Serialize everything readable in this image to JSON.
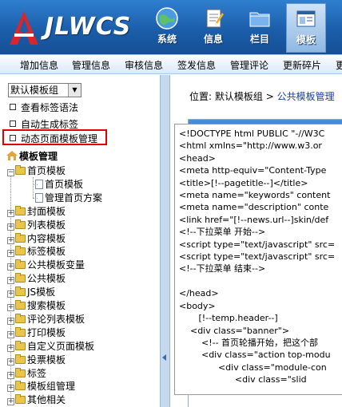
{
  "header": {
    "logo_text": "JLWCS",
    "nav": [
      {
        "label": "系统",
        "icon": "globe-icon"
      },
      {
        "label": "信息",
        "icon": "document-icon"
      },
      {
        "label": "栏目",
        "icon": "folder-icon"
      },
      {
        "label": "模板",
        "icon": "template-icon",
        "active": true
      }
    ],
    "colors": {
      "header_bg": "#1b5eaa",
      "active_tab": "#a9cbee"
    }
  },
  "menubar": {
    "items": [
      "增加信息",
      "管理信息",
      "审核信息",
      "签发信息",
      "管理评论",
      "更新碎片",
      "更新"
    ]
  },
  "sidebar": {
    "group_select": {
      "value": "默认模板组"
    },
    "links": [
      "查看标签语法",
      "自动生成标签",
      "动态页面模板管理"
    ],
    "highlight_color": "#e00000",
    "tree_root": "模板管理",
    "tree": [
      {
        "label": "首页模板",
        "expanded": true
      },
      {
        "label": "首页模板",
        "child": true
      },
      {
        "label": "管理首页方案",
        "child": true
      },
      {
        "label": "封面模板"
      },
      {
        "label": "列表模板"
      },
      {
        "label": "内容模板"
      },
      {
        "label": "标签模板"
      },
      {
        "label": "公共模板变量"
      },
      {
        "label": "公共模板"
      },
      {
        "label": "JS模板"
      },
      {
        "label": "搜索模板"
      },
      {
        "label": "评论列表模板"
      },
      {
        "label": "打印模板"
      },
      {
        "label": "自定义页面模板"
      },
      {
        "label": "投票模板"
      },
      {
        "label": "标签"
      },
      {
        "label": "模板组管理"
      },
      {
        "label": "其他相关"
      }
    ]
  },
  "main": {
    "breadcrumb": {
      "prefix": "位置: 默认模板组",
      "separator": ">",
      "current": "公共模板管理"
    },
    "panel_header_color": "#2f74c3",
    "code": "<!DOCTYPE html PUBLIC \"-//W3C\n<html xmlns=\"http://www.w3.or\n<head>\n<meta http-equiv=\"Content-Type\n<title>[!--pagetitle--]</title>\n<meta name=\"keywords\" content\n<meta name=\"description\" conte\n<link href=\"[!--news.url--]skin/def\n<!--下拉菜单 开始-->\n<script type=\"text/javascript\" src=\n<script type=\"text/javascript\" src=\n<!--下拉菜单 结束-->\n\n</head>\n<body>\n       [!--temp.header--]\n    <div class=\"banner\">\n        <!-- 首页轮播开始，把这个部\n        <div class=\"action top-modu\n              <div class=\"module-con\n                    <div class=\"slid"
  }
}
